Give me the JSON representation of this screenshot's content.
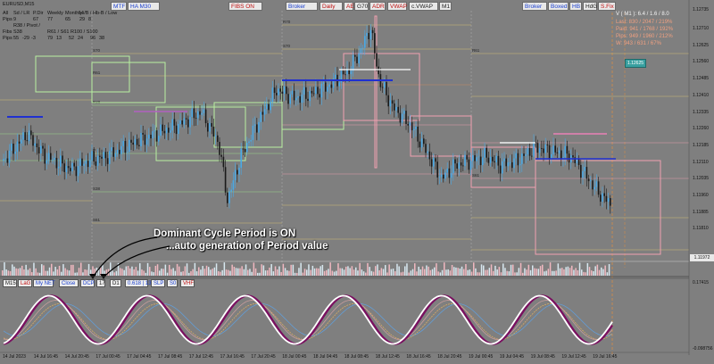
{
  "symbol": "EURUSD,M15",
  "toolbar_top": [
    {
      "label": "MTF",
      "style": "blue"
    },
    {
      "label": "HA M30",
      "style": "blue"
    },
    {
      "label": "FIBS ON",
      "style": "red"
    },
    {
      "label": "Broker",
      "style": "blue"
    },
    {
      "label": "Daily",
      "style": "red"
    },
    {
      "label": "AE",
      "style": "red"
    },
    {
      "label": "G70",
      "style": ""
    },
    {
      "label": "ADR",
      "style": "red"
    },
    {
      "label": "VWAP",
      "style": "red"
    },
    {
      "label": "c.VWAP",
      "style": ""
    },
    {
      "label": "M1",
      "style": ""
    },
    {
      "label": "Broker",
      "style": "blue"
    },
    {
      "label": "Boxed",
      "style": "blue"
    },
    {
      "label": "HB",
      "style": "blue"
    },
    {
      "label": "HdG",
      "style": ""
    },
    {
      "label": "S.Fix",
      "style": "red"
    }
  ],
  "stats": {
    "header": [
      "All",
      "Sd / LR",
      "P.Dir",
      "Weekly",
      "Monthly",
      "Hi/B / Hb-B / Low"
    ],
    "row1": [
      "Pips",
      "9",
      "67",
      "77",
      "65",
      "29",
      "8"
    ],
    "row2": [
      "Fibs",
      "R38 / Pivot / S38",
      "R61 / S61",
      "R100 / S100"
    ],
    "row3": [
      "Pips",
      "55",
      "-29",
      "-3",
      "79",
      "13",
      "52",
      "24",
      "96",
      "38"
    ]
  },
  "right_info": {
    "vline": "V ( M1 ): 6.4 / 1.6 / 8.0",
    "last": "Last: 830 / 2047 / 219%",
    "paid": "Paid: 941 / 1768 / 192%",
    "pips": "Pips: 949 / 1960 / 212%",
    "w": "W: 943 / 631 / 67%"
  },
  "tag_price": "1.12625",
  "current_price": "1.11972",
  "price_axis": [
    "1.12710",
    "1.12625",
    "1.12560",
    "1.12485",
    "1.12410",
    "1.12335",
    "1.12260",
    "1.12185",
    "1.12110",
    "1.12035",
    "1.11960",
    "1.11885",
    "1.11810"
  ],
  "price_label_top": "1.12735",
  "osc_axis": [
    "0.17415",
    "-0.098756"
  ],
  "panel_buttons": [
    {
      "label": "M15",
      "style": ""
    },
    {
      "label": "LaG",
      "style": "red"
    },
    {
      "label": "My NET",
      "style": "blue"
    },
    {
      "label": "Close",
      "style": "blue"
    },
    {
      "label": "DCP",
      "style": "blue"
    },
    {
      "label": "17",
      "style": ""
    },
    {
      "label": "D1",
      "style": ""
    },
    {
      "label": "0.618 | 13",
      "style": "blue"
    },
    {
      "label": "SLP",
      "style": "blue"
    },
    {
      "label": "S0",
      "style": "blue"
    },
    {
      "label": "VHF",
      "style": "red"
    }
  ],
  "annotation": {
    "line1": "Dominant Cycle Period is ON",
    "line2": "...auto generation of Period value"
  },
  "time_axis": [
    "14 Jul 2023",
    "14 Jul 16:45",
    "14 Jul 20:45",
    "17 Jul 00:45",
    "17 Jul 04:45",
    "17 Jul 08:45",
    "17 Jul 12:45",
    "17 Jul 16:45",
    "17 Jul 20:45",
    "18 Jul 00:45",
    "18 Jul 04:45",
    "18 Jul 08:45",
    "18 Jul 12:45",
    "18 Jul 16:45",
    "18 Jul 20:45",
    "19 Jul 00:45",
    "19 Jul 04:45",
    "19 Jul 08:45",
    "19 Jul 12:45",
    "19 Jul 16:45"
  ],
  "fib_labels": [
    "S70",
    "R61",
    "R38",
    "P",
    "S38",
    "S61",
    "R70",
    "S70",
    "R61",
    "S61"
  ],
  "colors": {
    "background": "#7f7f7f",
    "bull_candle": "#49a9e6",
    "bear_candle": "#1a1a1a",
    "osc_main": "#ffffff",
    "osc_signal": "#7a1060",
    "box_green": "#b8f0a0",
    "box_pink": "#f0a0b0",
    "vwap_blue": "#2030d0"
  }
}
